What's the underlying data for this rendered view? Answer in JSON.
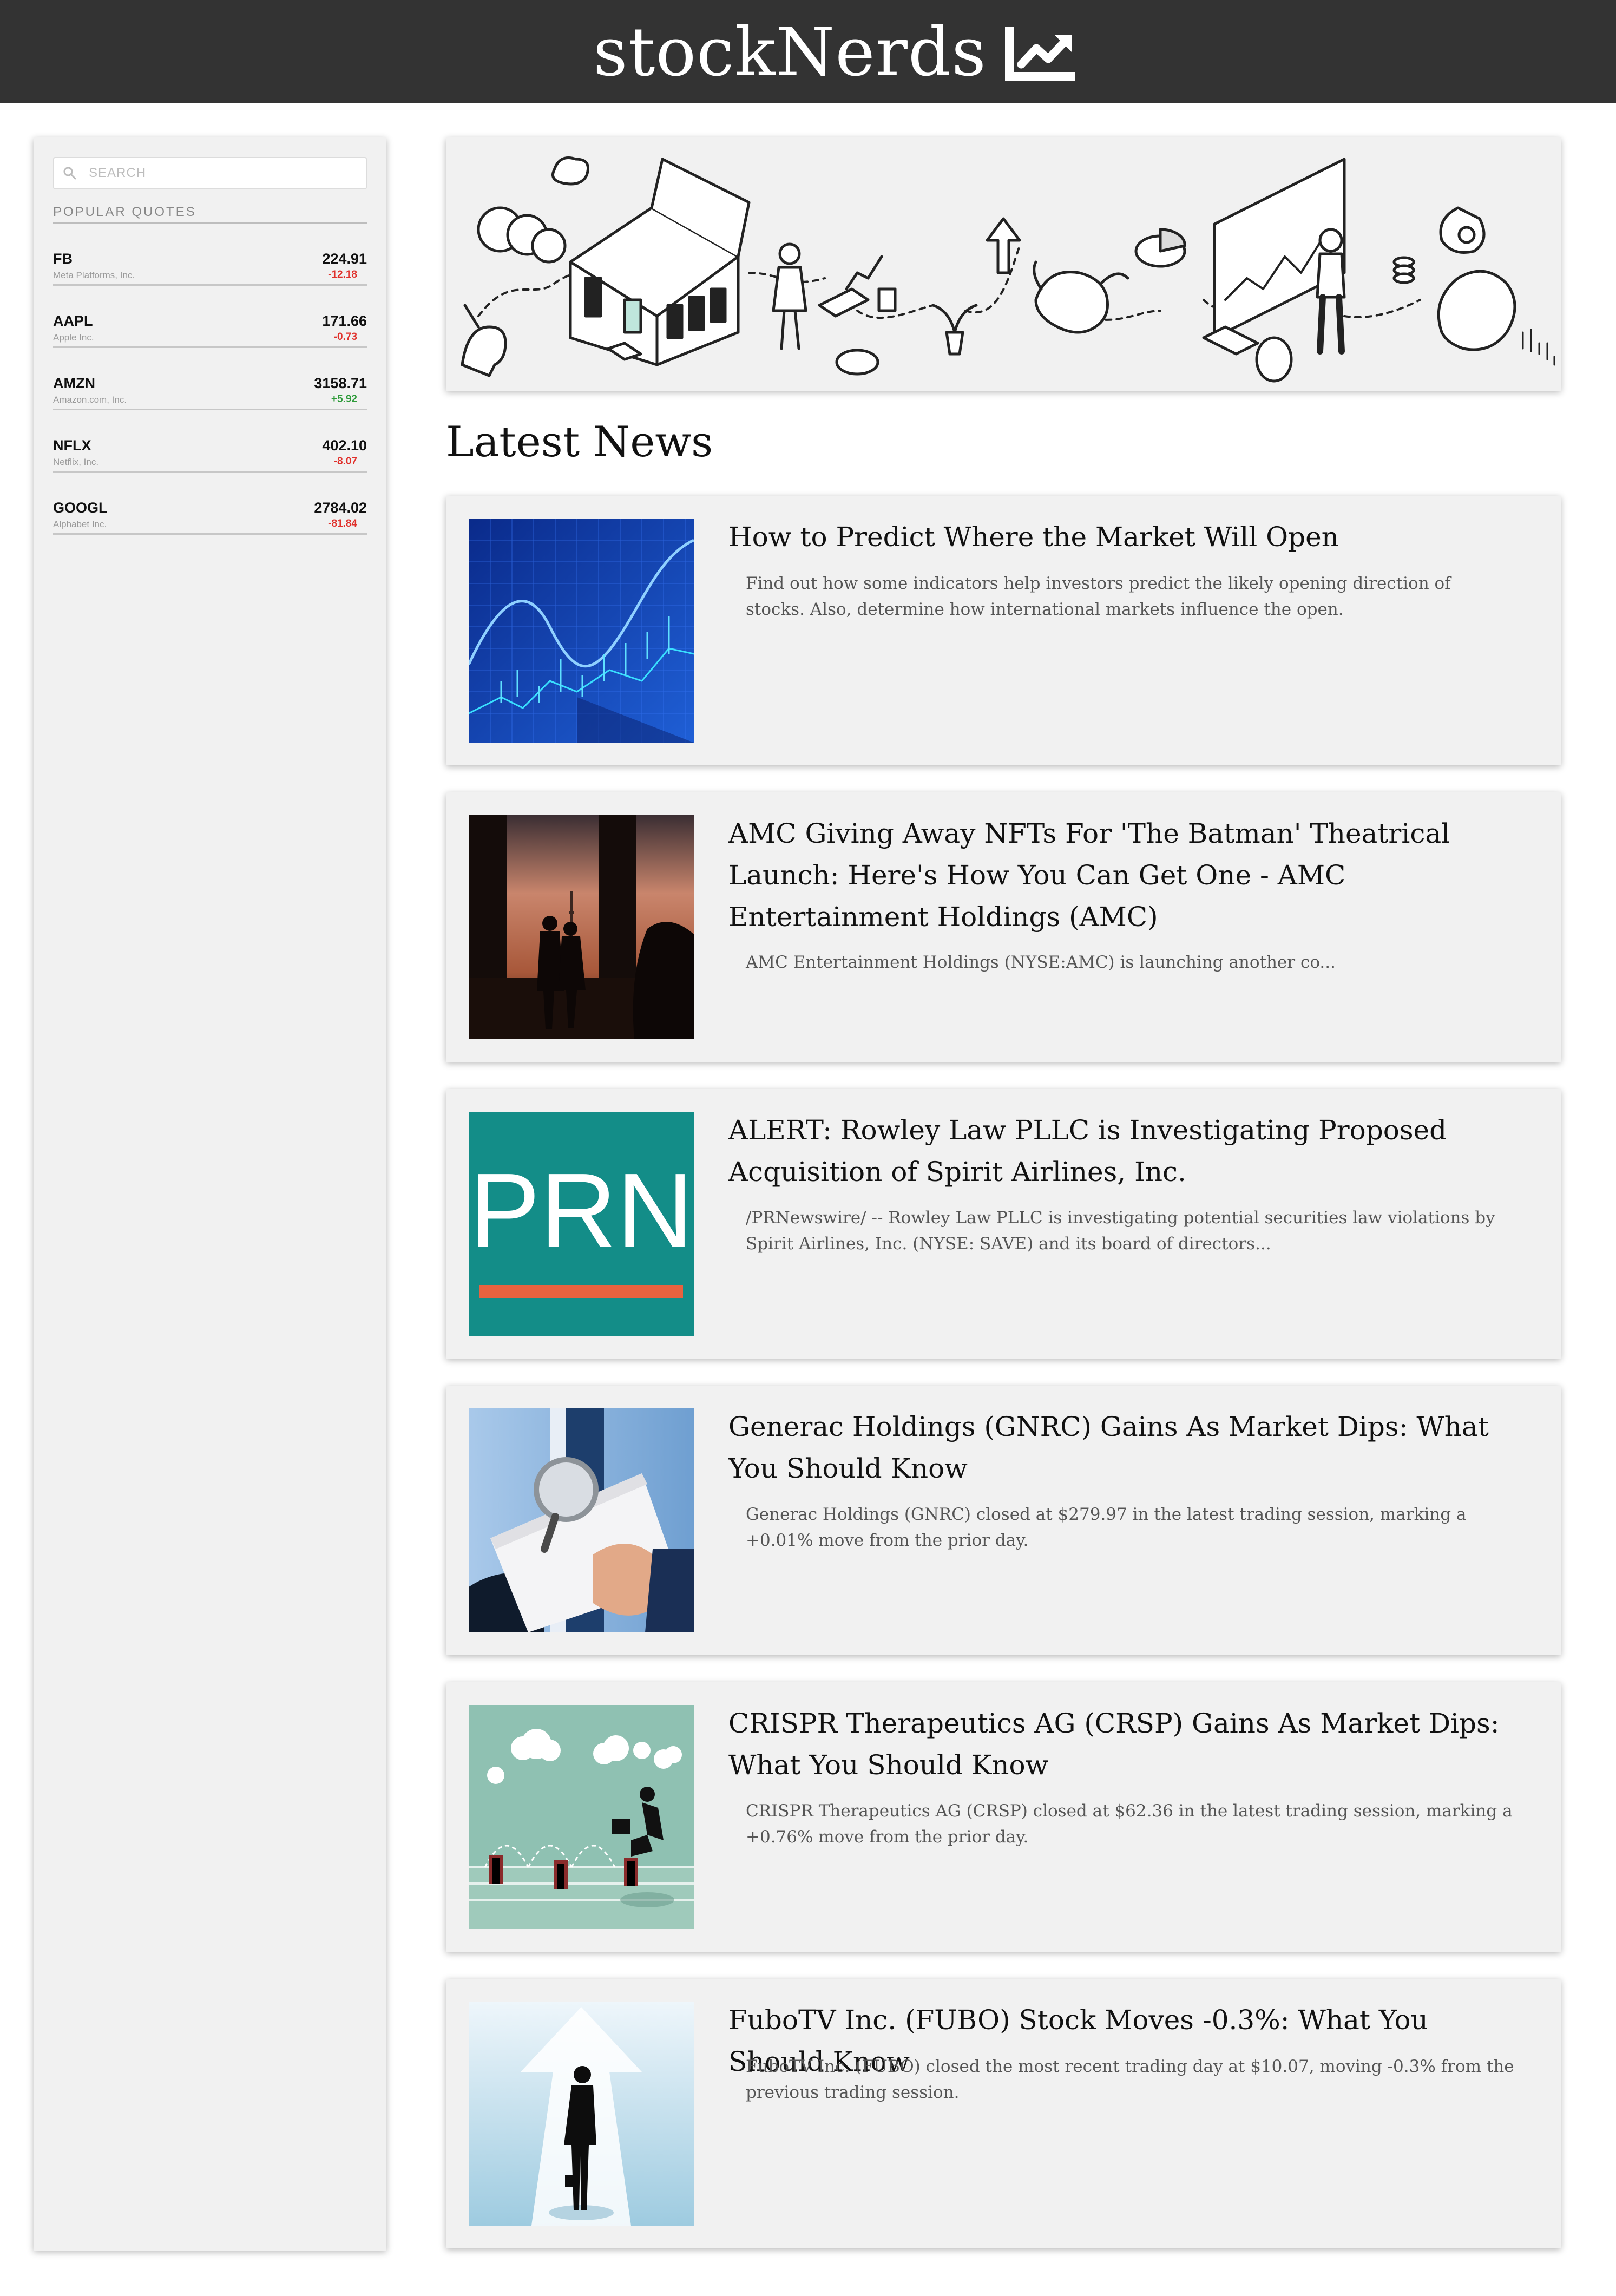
{
  "header": {
    "brand": "stockNerds",
    "logo_icon": "trending-up-chart-icon"
  },
  "sidebar": {
    "search_placeholder": "SEARCH",
    "section_title": "POPULAR QUOTES",
    "quotes": [
      {
        "symbol": "FB",
        "name": "Meta Platforms, Inc.",
        "price": "224.91",
        "change": "-12.18",
        "direction": "down"
      },
      {
        "symbol": "AAPL",
        "name": "Apple Inc.",
        "price": "171.66",
        "change": "-0.73",
        "direction": "down"
      },
      {
        "symbol": "AMZN",
        "name": "Amazon.com, Inc.",
        "price": "3158.71",
        "change": "+5.92",
        "direction": "up"
      },
      {
        "symbol": "NFLX",
        "name": "Netflix, Inc.",
        "price": "402.10",
        "change": "-8.07",
        "direction": "down"
      },
      {
        "symbol": "GOOGL",
        "name": "Alphabet Inc.",
        "price": "2784.02",
        "change": "-81.84",
        "direction": "down"
      }
    ]
  },
  "main": {
    "banner_image": "stock-market-illustration",
    "section_title": "Latest News",
    "news": [
      {
        "headline": "How to Predict Where the Market Will Open",
        "description": "Find out how some indicators help investors predict the likely opening direction of stocks. Also, determine how international markets influence the open.",
        "image": "blue-stock-chart-thumbnail"
      },
      {
        "headline": "AMC Giving Away NFTs For 'The Batman' Theatrical Launch: Here's How You Can Get One - AMC Entertainment Holdings (AMC)",
        "description": "AMC Entertainment Holdings (NYSE:AMC) is launching another co...",
        "image": "city-sunset-silhouette-thumbnail"
      },
      {
        "headline": "ALERT: Rowley Law PLLC is Investigating Proposed Acquisition of Spirit Airlines, Inc.",
        "description": "/PRNewswire/ -- Rowley Law PLLC is investigating potential securities law violations by Spirit Airlines, Inc. (NYSE: SAVE) and its board of directors...",
        "image": "prn-logo-thumbnail",
        "image_text": "PRN"
      },
      {
        "headline": "Generac Holdings (GNRC) Gains As Market Dips: What You Should Know",
        "description": "Generac Holdings (GNRC) closed at $279.97 in the latest trading session, marking a +0.01% move from the prior day.",
        "image": "magnifying-glass-document-thumbnail"
      },
      {
        "headline": "CRISPR Therapeutics AG (CRSP) Gains As Market Dips: What You Should Know",
        "description": "CRISPR Therapeutics AG (CRSP) closed at $62.36 in the latest trading session, marking a +0.76% move from the prior day.",
        "image": "hurdle-runner-thumbnail"
      },
      {
        "headline": "FuboTV Inc. (FUBO) Stock Moves -0.3%: What You Should Know",
        "description": "FuboTV Inc. (FUBO) closed the most recent trading day at $10.07, moving -0.3% from the previous trading session.",
        "image": "businessman-arrow-thumbnail"
      }
    ]
  },
  "colors": {
    "header_bg": "#333333",
    "panel_bg": "#f1f1f1",
    "negative": "#e0302b",
    "positive": "#2e9b3a"
  }
}
